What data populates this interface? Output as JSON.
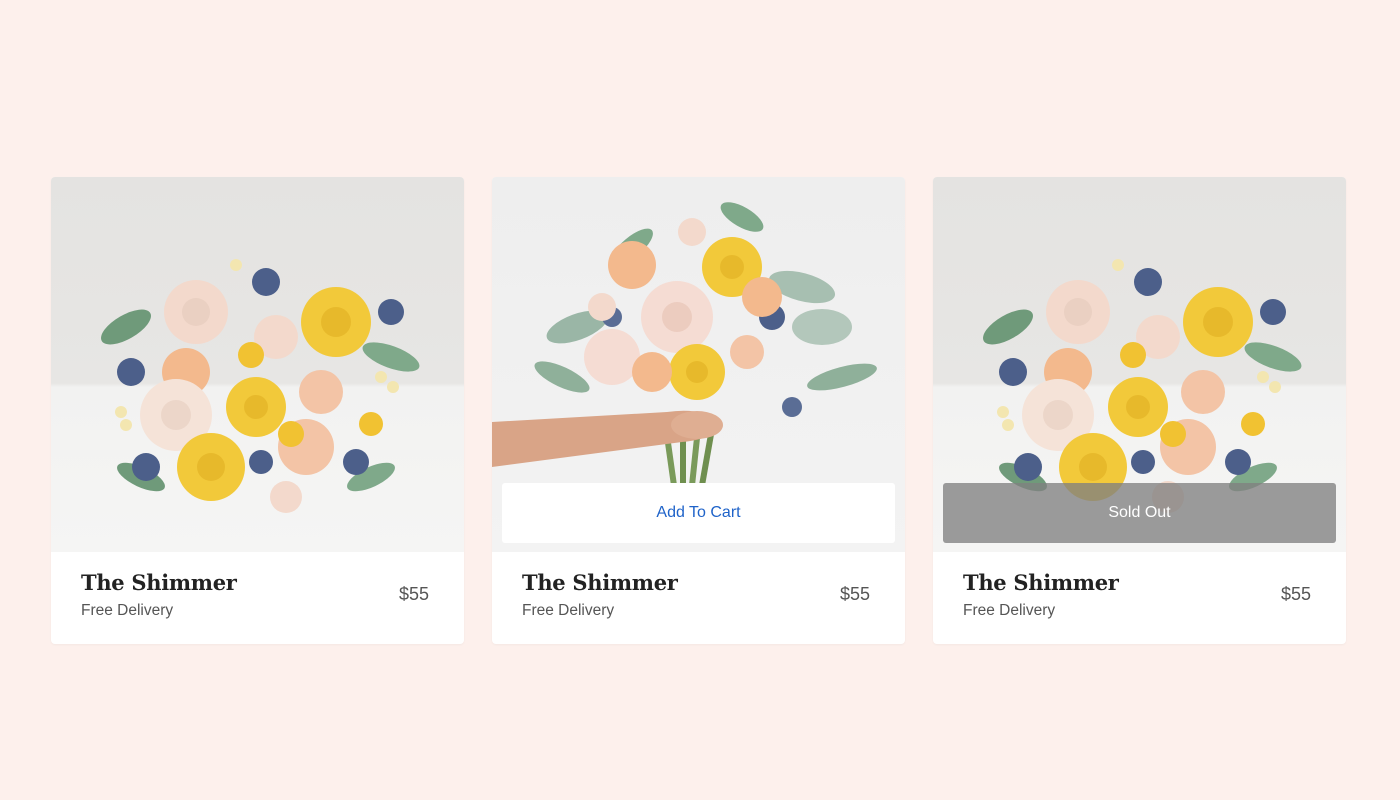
{
  "products": [
    {
      "image_icon": "bouquet-image",
      "name": "The Shimmer",
      "delivery": "Free Delivery",
      "price": "$55",
      "overlay": ""
    },
    {
      "image_icon": "bouquet-in-hand-image",
      "name": "The Shimmer",
      "delivery": "Free Delivery",
      "price": "$55",
      "overlay": "Add To Cart"
    },
    {
      "image_icon": "bouquet-image",
      "name": "The Shimmer",
      "delivery": "Free Delivery",
      "price": "$55",
      "overlay": "Sold Out"
    }
  ],
  "colors": {
    "page_background": "#fdf0ec",
    "card_background": "#ffffff",
    "add_to_cart_text": "#1f63c9",
    "sold_out_overlay": "#808080",
    "rose_yellow": "#f2c93a",
    "rose_blush": "#f3d9cc",
    "rose_peach": "#f3b98d",
    "thistle_blue": "#4c5f8a",
    "foliage_green": "#7fa98a"
  }
}
